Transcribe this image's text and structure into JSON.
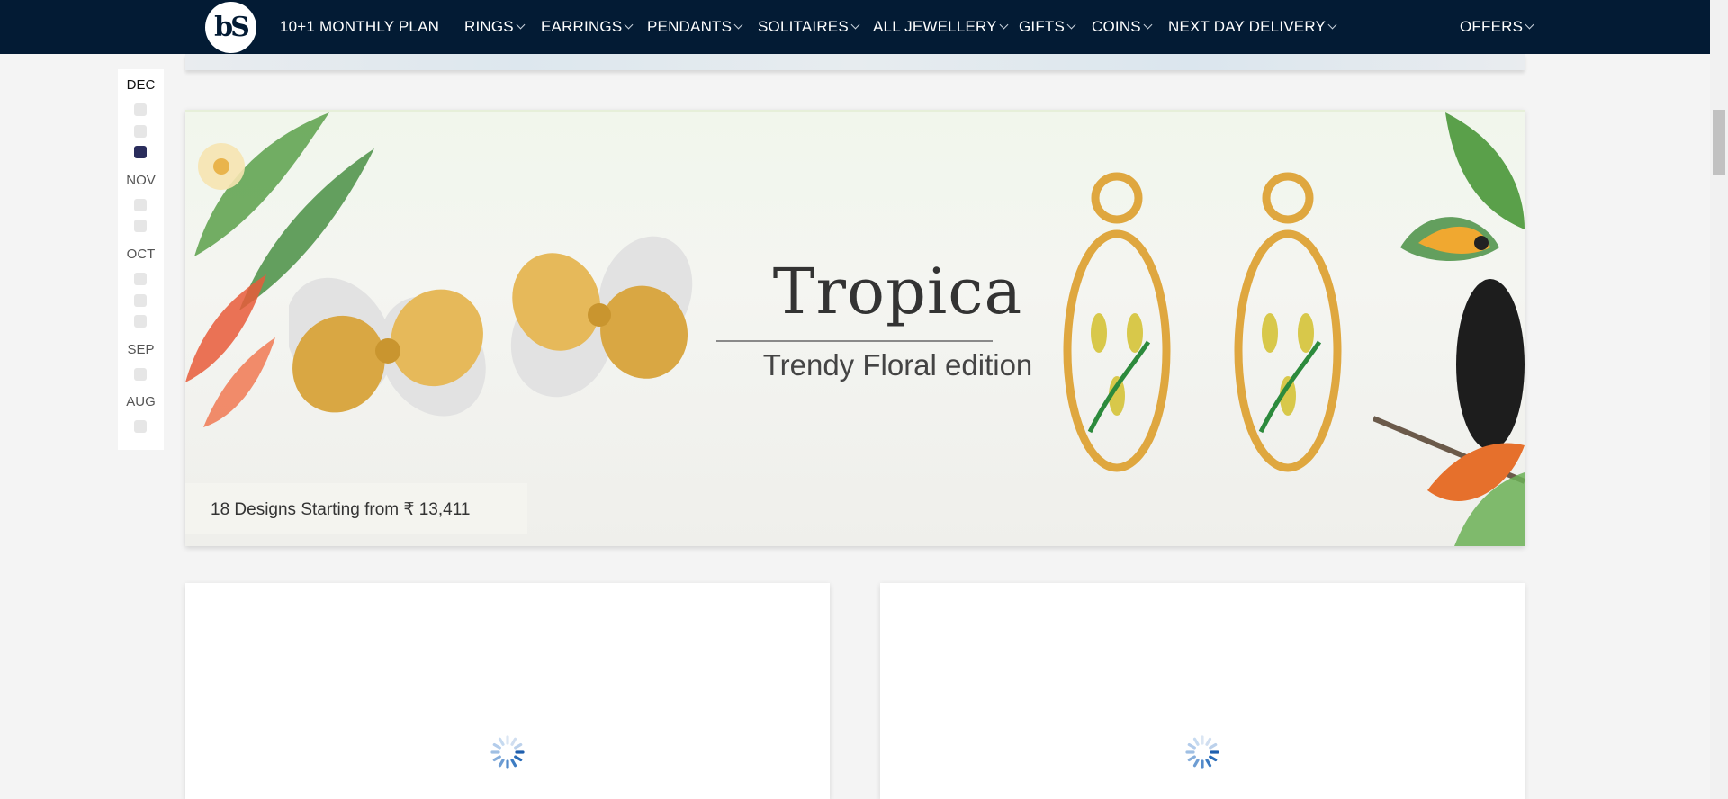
{
  "nav": {
    "logo_text": "bS",
    "items": [
      {
        "label": "10+1 MONTHLY PLAN",
        "dropdown": false
      },
      {
        "label": "RINGS",
        "dropdown": true
      },
      {
        "label": "EARRINGS",
        "dropdown": true
      },
      {
        "label": "PENDANTS",
        "dropdown": true
      },
      {
        "label": "SOLITAIRES",
        "dropdown": true
      },
      {
        "label": "ALL JEWELLERY",
        "dropdown": true
      },
      {
        "label": "GIFTS",
        "dropdown": true
      },
      {
        "label": "COINS",
        "dropdown": true
      },
      {
        "label": "NEXT DAY DELIVERY",
        "dropdown": true
      }
    ],
    "offers_label": "OFFERS"
  },
  "timeline": {
    "months": [
      {
        "label": "DEC",
        "active": true
      },
      {
        "label": "NOV",
        "active": false
      },
      {
        "label": "OCT",
        "active": false
      },
      {
        "label": "SEP",
        "active": false
      },
      {
        "label": "AUG",
        "active": false
      }
    ]
  },
  "banner": {
    "title": "Tropica",
    "subtitle": "Trendy Floral edition",
    "caption": "18 Designs Starting from ₹ 13,411"
  },
  "colors": {
    "nav_bg": "#031b34",
    "active_dot": "#2a2d5c",
    "page_bg": "#f4f4f4",
    "spinner": "#2f6db5"
  },
  "icons": [
    "logo-icon",
    "chevron-down-icon",
    "loading-spinner-icon",
    "earring-illustration",
    "toucan-illustration"
  ]
}
